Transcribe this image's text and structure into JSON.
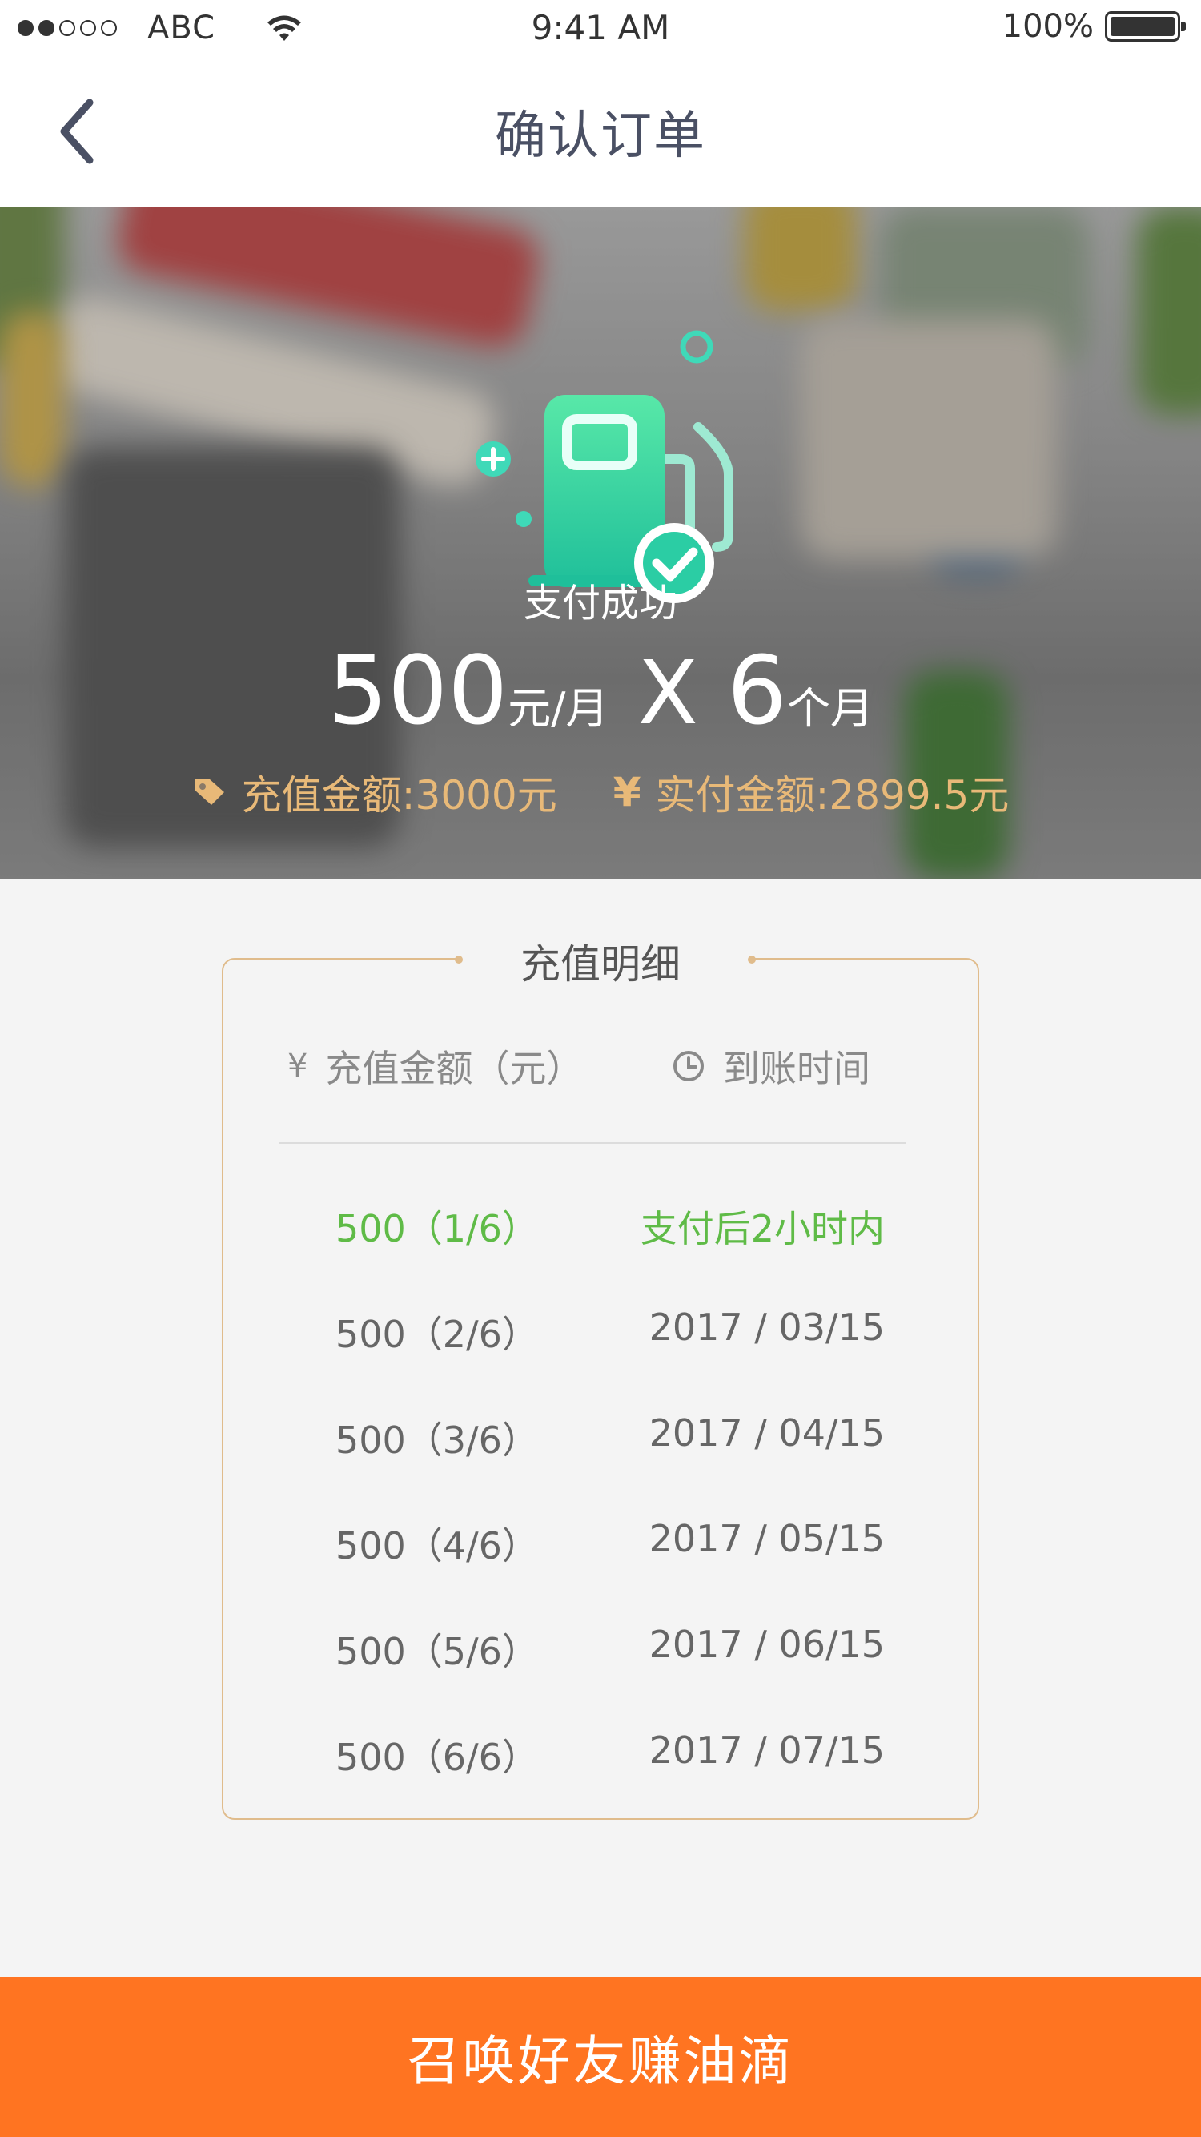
{
  "status_bar": {
    "carrier": "ABC",
    "time": "9:41 AM",
    "battery": "100%"
  },
  "nav": {
    "title": "确认订单"
  },
  "hero": {
    "status": "支付成功",
    "price": "500",
    "price_unit": "元/月",
    "multiplier": "X",
    "months": "6",
    "months_unit": "个月",
    "recharge_amount": "充值金额:3000元",
    "paid_amount": "实付金额:2899.5元",
    "yen_symbol": "¥"
  },
  "detail": {
    "title": "充值明细",
    "col_amount": "充值金额（元）",
    "col_time": "到账时间",
    "yen_symbol": "¥",
    "rows": [
      {
        "amount": "500（1/6）",
        "time": "支付后2小时内"
      },
      {
        "amount": "500（2/6）",
        "time": "2017 / 03/15"
      },
      {
        "amount": "500（3/6）",
        "time": "2017 / 04/15"
      },
      {
        "amount": "500（4/6）",
        "time": "2017 / 05/15"
      },
      {
        "amount": "500（5/6）",
        "time": "2017 / 06/15"
      },
      {
        "amount": "500（6/6）",
        "time": "2017 / 07/15"
      }
    ]
  },
  "bottom_button": {
    "label": "召唤好友赚油滴"
  },
  "colors": {
    "accent_orange": "#ff7421",
    "success_green": "#5fbb47",
    "gold": "#e8b978",
    "pump_teal": "#2ed3a8"
  }
}
